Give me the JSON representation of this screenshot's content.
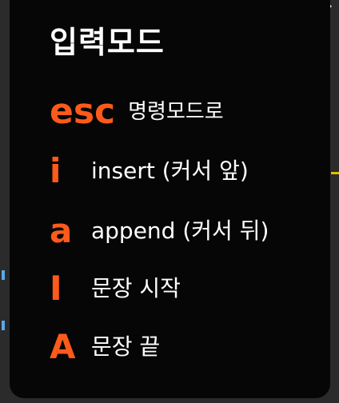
{
  "title": "입력모드",
  "commands": [
    {
      "key": "esc",
      "description": "명령모드로"
    },
    {
      "key": "i",
      "description": "insert (커서 앞)"
    },
    {
      "key": "a",
      "description": "append (커서 뒤)"
    },
    {
      "key": "I",
      "description": "문장 시작"
    },
    {
      "key": "A",
      "description": "문장 끝"
    }
  ],
  "colors": {
    "key": "#ff5a1a",
    "text": "#ffffff",
    "card_background": "#060606",
    "page_background": "#2b2b2b"
  },
  "icons": {
    "top_left": "history-icon",
    "top_right": "share-icon"
  }
}
